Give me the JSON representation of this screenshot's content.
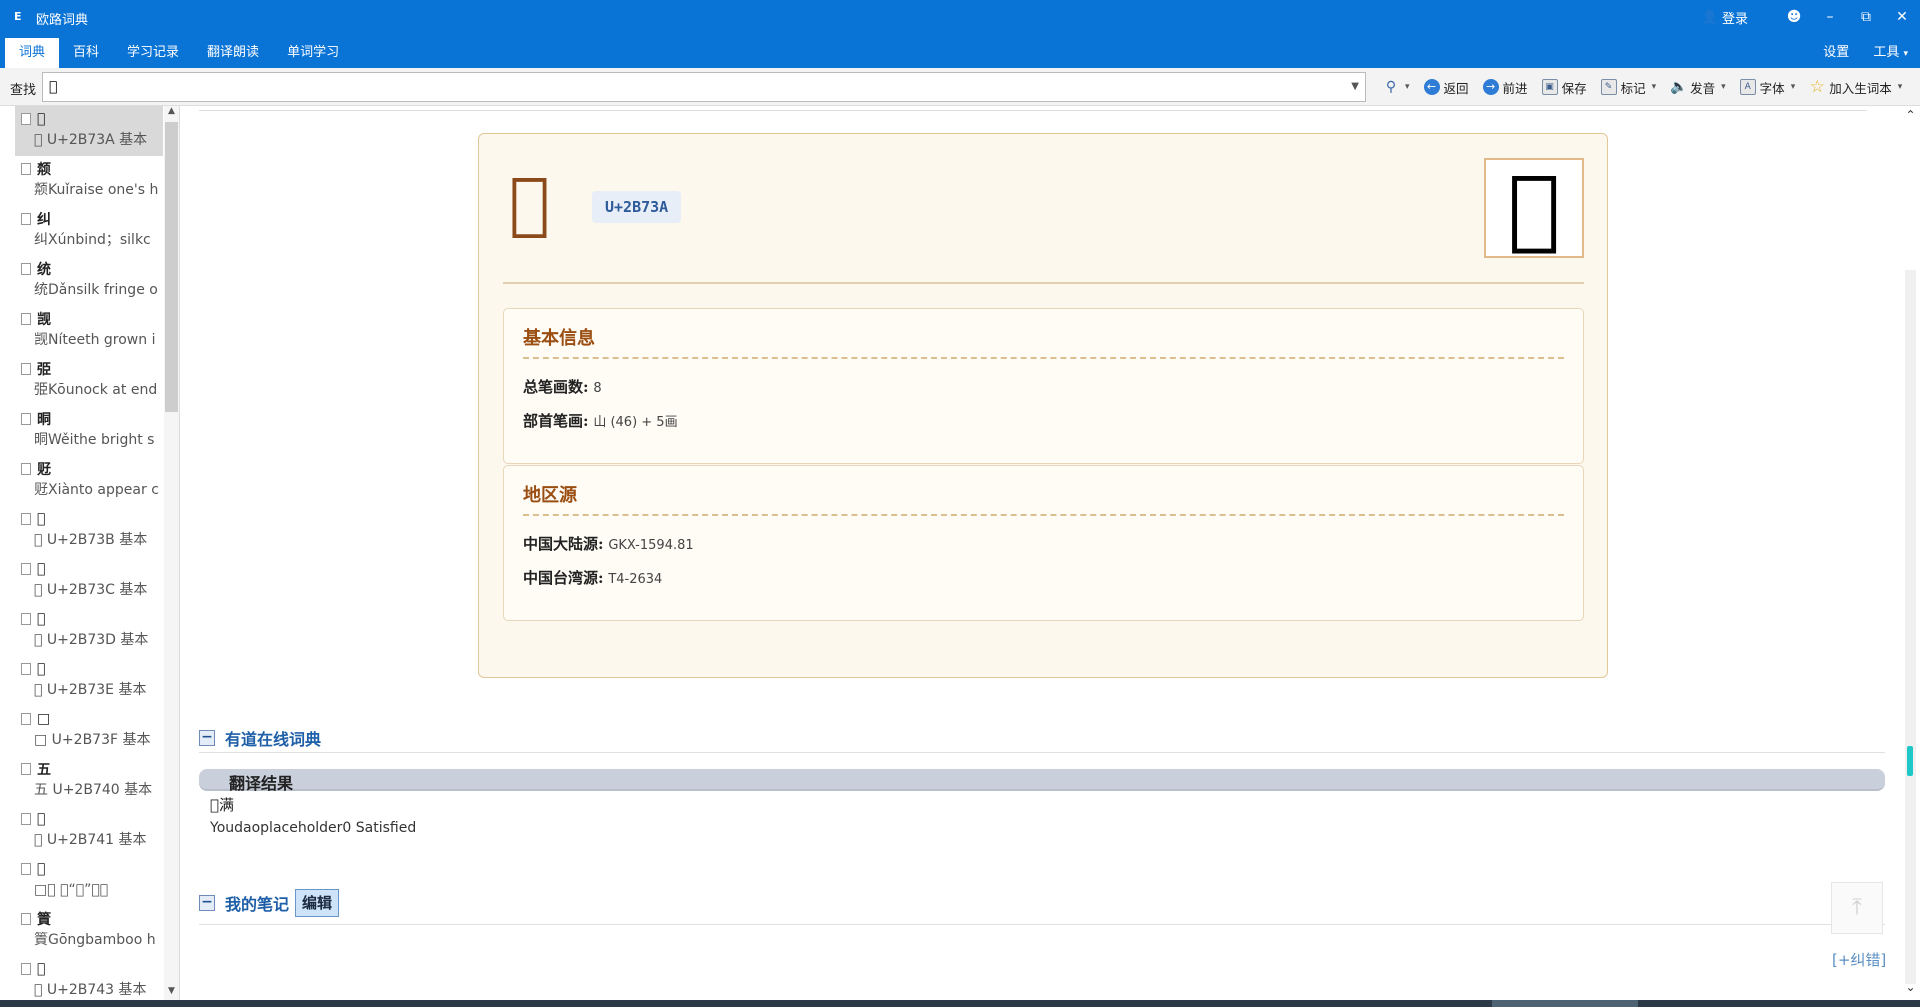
{
  "app": {
    "title": "欧路词典",
    "icon_name": "app-logo-icon",
    "login": "登录"
  },
  "menu": {
    "tabs": [
      "词典",
      "百科",
      "学习记录",
      "翻译朗读",
      "单词学习"
    ],
    "right": [
      "设置",
      "工具"
    ]
  },
  "search": {
    "label": "查找",
    "value": "𫜺"
  },
  "toolbar": {
    "back": "返回",
    "forward": "前进",
    "save": "保存",
    "mark": "标记",
    "speak": "发音",
    "font": "字体",
    "add_wordbook": "加入生词本"
  },
  "word_list": [
    {
      "head": "𫜺",
      "sub": "𫜺 U+2B73A 基本"
    },
    {
      "head": "颒",
      "sub": "颒Kuǐraise one's h"
    },
    {
      "head": "纠",
      "sub": "纠Xúnbind；silkc"
    },
    {
      "head": "统",
      "sub": "统Dǎnsilk fringe o"
    },
    {
      "head": "觊",
      "sub": "觊Níteeth grown i"
    },
    {
      "head": "弫",
      "sub": "弫Kōunock at end"
    },
    {
      "head": "晍",
      "sub": "晍Wěithe bright s"
    },
    {
      "head": "觃",
      "sub": "觃Xiànto appear c"
    },
    {
      "head": "𫜻",
      "sub": "𫜻 U+2B73B 基本"
    },
    {
      "head": "𫜼",
      "sub": "𫜼 U+2B73C 基本"
    },
    {
      "head": "𫜽",
      "sub": "𫜽 U+2B73D 基本"
    },
    {
      "head": "𫜾",
      "sub": "𫜾 U+2B73E 基本"
    },
    {
      "head": "□",
      "sub": "□ U+2B73F 基本"
    },
    {
      "head": "五",
      "sub": "五 U+2B740 基本"
    },
    {
      "head": "𫝁",
      "sub": "𫝁 U+2B741 基本"
    },
    {
      "head": "𫝂",
      "sub": "□𫝂 同“所”。一"
    },
    {
      "head": "篢",
      "sub": "篢Gōngbamboo h"
    },
    {
      "head": "𫝃",
      "sub": "𫝃 U+2B743 基本"
    }
  ],
  "entry": {
    "char": "𫜺",
    "code": "U+2B73A",
    "glyph": "𫜺",
    "basic": {
      "title": "基本信息",
      "strokes_label": "总笔画数:",
      "strokes_value": "8",
      "radical_label": "部首笔画:",
      "radical_value": "山 (46) + 5画"
    },
    "source": {
      "title": "地区源",
      "mainland_label": "中国大陆源:",
      "mainland_value": "GKX-1594.81",
      "taiwan_label": "中国台湾源:",
      "taiwan_value": "T4-2634"
    }
  },
  "youdao": {
    "title": "有道在线词典",
    "result_header": "翻译结果",
    "line1": "𫜺满",
    "line2": "Youdaoplaceholder0 Satisfied"
  },
  "notes": {
    "title": "我的笔记",
    "edit": "编辑",
    "report": "[+纠错]"
  },
  "colors": {
    "accent": "#0a73d6",
    "card_bg": "#fdf8ee",
    "heading": "#9a4e12"
  }
}
